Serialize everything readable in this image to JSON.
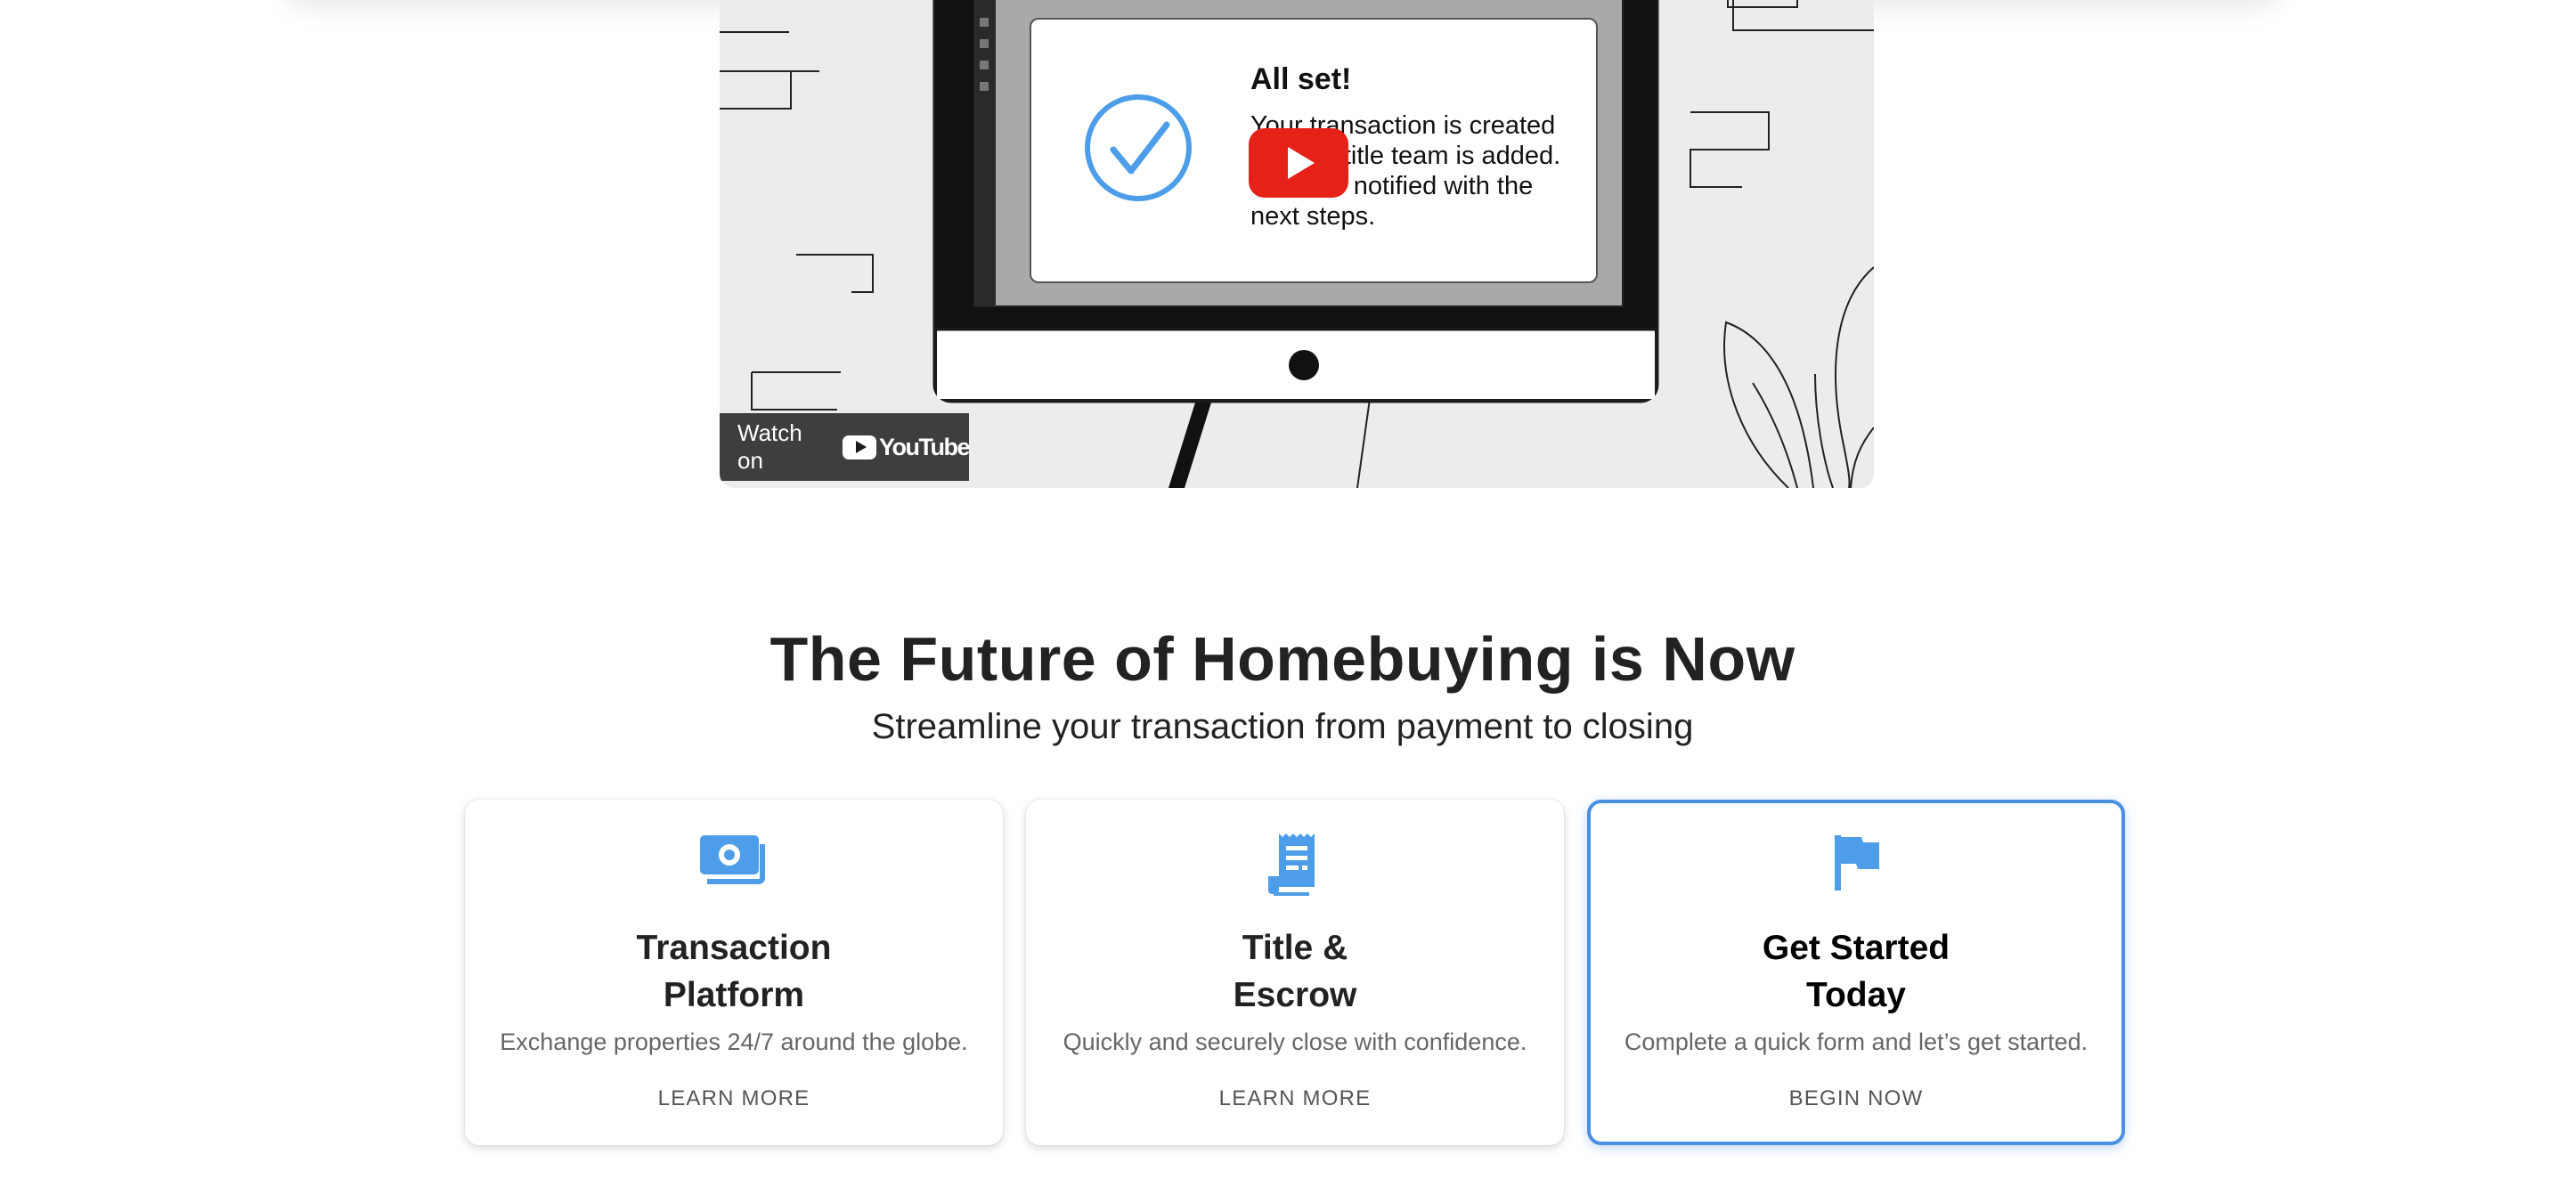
{
  "video": {
    "modal_title": "All set!",
    "modal_body": "Your transaction is created and the title team is added. You'll be notified with the next steps.",
    "watch_on": "Watch on",
    "youtube_wordmark": "YouTube",
    "play_button_color": "#e62117"
  },
  "section": {
    "title": "The Future of Homebuying is Now",
    "subtitle": "Streamline your transaction from payment to closing"
  },
  "cards": [
    {
      "icon": "money-bill-icon",
      "title_line1": "Transaction",
      "title_line2": "Platform",
      "description": "Exchange properties 24/7 around the globe.",
      "link": "LEARN MORE"
    },
    {
      "icon": "receipt-document-icon",
      "title_line1": "Title &",
      "title_line2": "Escrow",
      "description": "Quickly and securely close with confidence.",
      "link": "LEARN MORE"
    },
    {
      "icon": "flag-icon",
      "title_line1": "Get Started",
      "title_line2": "Today",
      "description": "Complete a quick form and let’s get started.",
      "link": "BEGIN NOW",
      "highlighted": true
    }
  ],
  "colors": {
    "accent": "#4a90e2",
    "icon": "#4d9de8",
    "heading": "#222222",
    "muted_text": "#666666"
  }
}
